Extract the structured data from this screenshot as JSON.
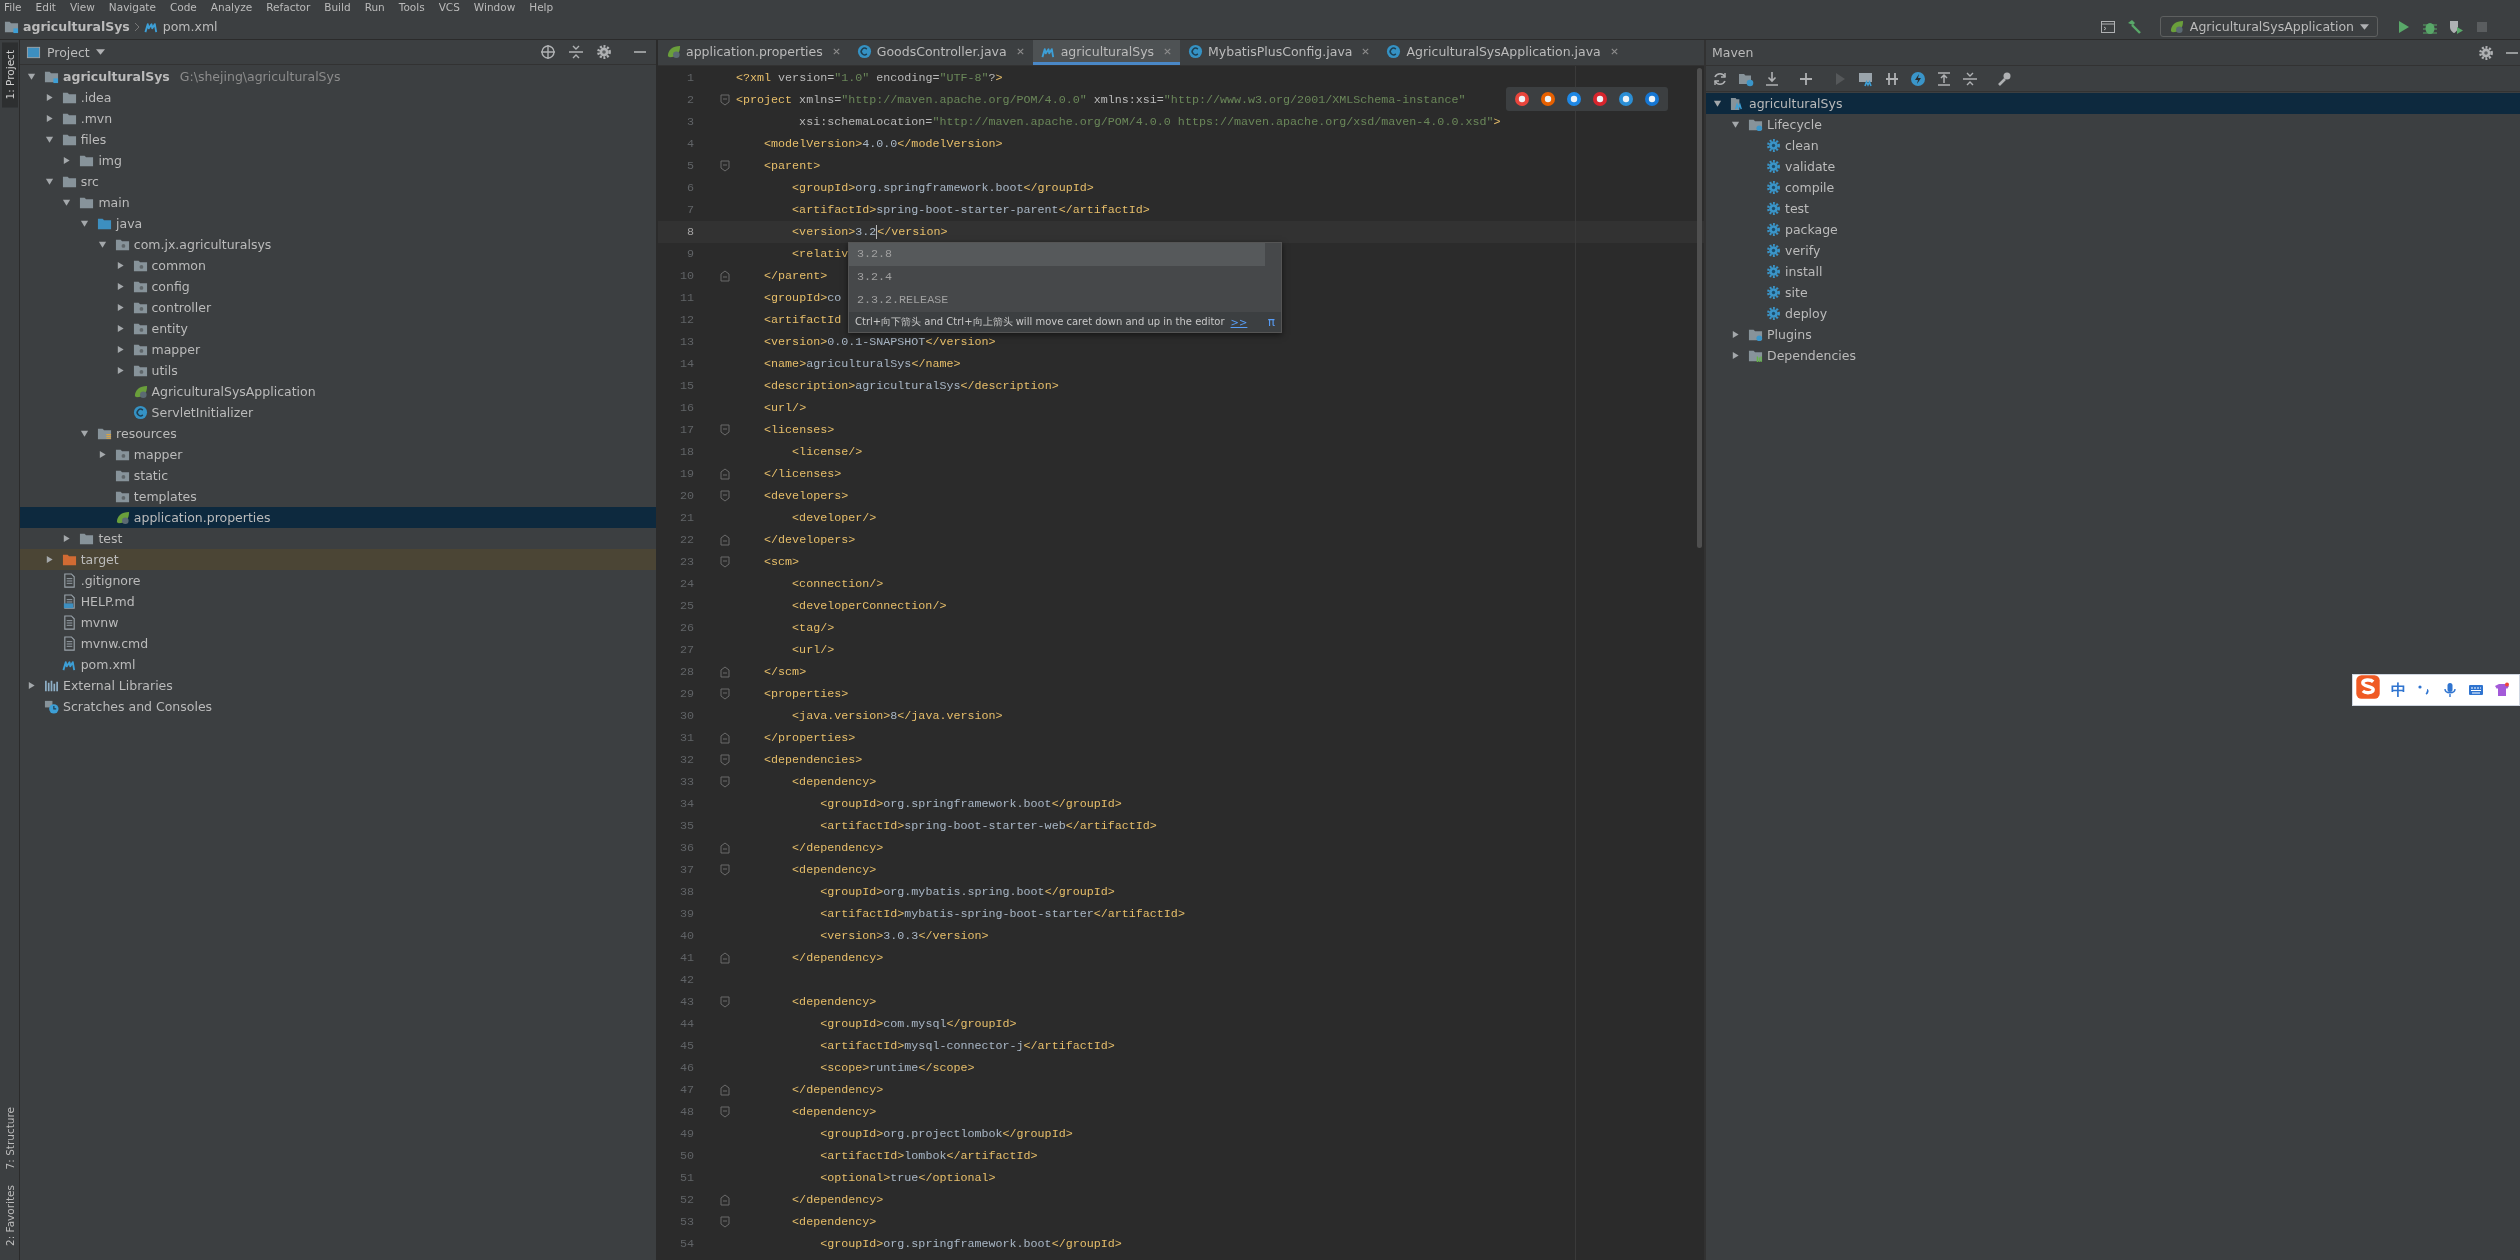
{
  "menu": [
    "File",
    "Edit",
    "View",
    "Navigate",
    "Code",
    "Analyze",
    "Refactor",
    "Build",
    "Run",
    "Tools",
    "VCS",
    "Window",
    "Help"
  ],
  "breadcrumb": [
    {
      "label": "agriculturalSys",
      "kind": "module"
    },
    {
      "label": "pom.xml",
      "kind": "maven"
    }
  ],
  "run_config": {
    "label": "AgriculturalSysApplication"
  },
  "side_tabs_top": [
    {
      "label": "1: Project",
      "selected": true
    }
  ],
  "side_tabs_bottom": [
    {
      "label": "7: Structure",
      "selected": false
    },
    {
      "label": "2: Favorites",
      "selected": false
    }
  ],
  "project_panel": {
    "title": "Project",
    "tree": [
      {
        "label": "agriculturalSys",
        "path": "G:\\shejing\\agriculturalSys",
        "kind": "module",
        "expanded": true,
        "selected": false,
        "children": [
          {
            "label": ".idea",
            "kind": "folder",
            "expanded": false,
            "selected": false
          },
          {
            "label": ".mvn",
            "kind": "folder",
            "expanded": false,
            "selected": false
          },
          {
            "label": "files",
            "kind": "folder",
            "expanded": true,
            "selected": false,
            "children": [
              {
                "label": "img",
                "kind": "folder",
                "expanded": false,
                "selected": false
              }
            ]
          },
          {
            "label": "src",
            "kind": "folder",
            "expanded": true,
            "selected": false,
            "children": [
              {
                "label": "main",
                "kind": "folder",
                "expanded": true,
                "selected": false,
                "children": [
                  {
                    "label": "java",
                    "kind": "source",
                    "expanded": true,
                    "selected": false,
                    "children": [
                      {
                        "label": "com.jx.agriculturalsys",
                        "kind": "package",
                        "expanded": true,
                        "selected": false,
                        "children": [
                          {
                            "label": "common",
                            "kind": "package",
                            "expanded": false,
                            "selected": false
                          },
                          {
                            "label": "config",
                            "kind": "package",
                            "expanded": false,
                            "selected": false
                          },
                          {
                            "label": "controller",
                            "kind": "package",
                            "expanded": false,
                            "selected": false
                          },
                          {
                            "label": "entity",
                            "kind": "package",
                            "expanded": false,
                            "selected": false
                          },
                          {
                            "label": "mapper",
                            "kind": "package",
                            "expanded": false,
                            "selected": false
                          },
                          {
                            "label": "utils",
                            "kind": "package",
                            "expanded": false,
                            "selected": false
                          },
                          {
                            "label": "AgriculturalSysApplication",
                            "kind": "spring",
                            "selected": false
                          },
                          {
                            "label": "ServletInitializer",
                            "kind": "class",
                            "selected": false
                          }
                        ]
                      }
                    ]
                  },
                  {
                    "label": "resources",
                    "kind": "resources",
                    "expanded": true,
                    "selected": false,
                    "children": [
                      {
                        "label": "mapper",
                        "kind": "package",
                        "expanded": false,
                        "selected": false
                      },
                      {
                        "label": "static",
                        "kind": "package",
                        "selected": false
                      },
                      {
                        "label": "templates",
                        "kind": "package",
                        "selected": false
                      },
                      {
                        "label": "application.properties",
                        "kind": "properties",
                        "selected": true
                      }
                    ]
                  }
                ]
              },
              {
                "label": "test",
                "kind": "folder",
                "expanded": false,
                "selected": false
              }
            ]
          },
          {
            "label": "target",
            "kind": "excluded",
            "expanded": false,
            "selected": false
          },
          {
            "label": ".gitignore",
            "kind": "file",
            "selected": false
          },
          {
            "label": "HELP.md",
            "kind": "markdown",
            "selected": false
          },
          {
            "label": "mvnw",
            "kind": "file",
            "selected": false
          },
          {
            "label": "mvnw.cmd",
            "kind": "file",
            "selected": false
          },
          {
            "label": "pom.xml",
            "kind": "maven",
            "selected": false
          }
        ]
      },
      {
        "label": "External Libraries",
        "kind": "libraries",
        "expanded": false,
        "selected": false
      },
      {
        "label": "Scratches and Consoles",
        "kind": "scratches",
        "selected": false
      }
    ]
  },
  "editor": {
    "tabs": [
      {
        "label": "application.properties",
        "kind": "properties",
        "selected": false
      },
      {
        "label": "GoodsController.java",
        "kind": "class",
        "selected": false
      },
      {
        "label": "agriculturalSys",
        "kind": "maven",
        "selected": true
      },
      {
        "label": "MybatisPlusConfig.java",
        "kind": "class",
        "selected": false
      },
      {
        "label": "AgriculturalSysApplication.java",
        "kind": "class",
        "selected": false
      }
    ],
    "lines": [
      {
        "n": "1",
        "text": "<?xml version=\"1.0\" encoding=\"UTF-8\"?>",
        "current": false
      },
      {
        "n": "2",
        "text": "<project xmlns=\"http://maven.apache.org/POM/4.0.0\" xmlns:xsi=\"http://www.w3.org/2001/XMLSchema-instance\"",
        "fold_start": true,
        "current": false
      },
      {
        "n": "3",
        "text": "         xsi:schemaLocation=\"http://maven.apache.org/POM/4.0.0 https://maven.apache.org/xsd/maven-4.0.0.xsd\">",
        "current": false
      },
      {
        "n": "4",
        "text": "    <modelVersion>4.0.0</modelVersion>",
        "current": false
      },
      {
        "n": "5",
        "text": "    <parent>",
        "fold_start": true,
        "current": false
      },
      {
        "n": "6",
        "text": "        <groupId>org.springframework.boot</groupId>",
        "current": false
      },
      {
        "n": "7",
        "text": "        <artifactId>spring-boot-starter-parent</artifactId>",
        "current": false
      },
      {
        "n": "8",
        "text": "        <version>3.2",
        "after_caret": "</version>",
        "current": true
      },
      {
        "n": "9",
        "text": "        <relativ",
        "current": false
      },
      {
        "n": "10",
        "text": "    </parent>",
        "fold_end": true,
        "current": false
      },
      {
        "n": "11",
        "text": "    <groupId>co",
        "current": false
      },
      {
        "n": "12",
        "text": "    <artifactId",
        "current": false
      },
      {
        "n": "13",
        "text": "    <version>0.0.1-SNAPSHOT</version>",
        "current": false
      },
      {
        "n": "14",
        "text": "    <name>agriculturalSys</name>",
        "current": false
      },
      {
        "n": "15",
        "text": "    <description>agriculturalSys</description>",
        "current": false
      },
      {
        "n": "16",
        "text": "    <url/>",
        "current": false
      },
      {
        "n": "17",
        "text": "    <licenses>",
        "fold_start": true,
        "current": false
      },
      {
        "n": "18",
        "text": "        <license/>",
        "current": false
      },
      {
        "n": "19",
        "text": "    </licenses>",
        "fold_end": true,
        "current": false
      },
      {
        "n": "20",
        "text": "    <developers>",
        "fold_start": true,
        "current": false
      },
      {
        "n": "21",
        "text": "        <developer/>",
        "current": false
      },
      {
        "n": "22",
        "text": "    </developers>",
        "fold_end": true,
        "current": false
      },
      {
        "n": "23",
        "text": "    <scm>",
        "fold_start": true,
        "current": false
      },
      {
        "n": "24",
        "text": "        <connection/>",
        "current": false
      },
      {
        "n": "25",
        "text": "        <developerConnection/>",
        "current": false
      },
      {
        "n": "26",
        "text": "        <tag/>",
        "current": false
      },
      {
        "n": "27",
        "text": "        <url/>",
        "current": false
      },
      {
        "n": "28",
        "text": "    </scm>",
        "fold_end": true,
        "current": false
      },
      {
        "n": "29",
        "text": "    <properties>",
        "fold_start": true,
        "current": false
      },
      {
        "n": "30",
        "text": "        <java.version>8</java.version>",
        "current": false
      },
      {
        "n": "31",
        "text": "    </properties>",
        "fold_end": true,
        "current": false
      },
      {
        "n": "32",
        "text": "    <dependencies>",
        "fold_start": true,
        "current": false
      },
      {
        "n": "33",
        "text": "        <dependency>",
        "fold_start": true,
        "current": false
      },
      {
        "n": "34",
        "text": "            <groupId>org.springframework.boot</groupId>",
        "current": false
      },
      {
        "n": "35",
        "text": "            <artifactId>spring-boot-starter-web</artifactId>",
        "current": false
      },
      {
        "n": "36",
        "text": "        </dependency>",
        "fold_end": true,
        "current": false
      },
      {
        "n": "37",
        "text": "        <dependency>",
        "fold_start": true,
        "current": false
      },
      {
        "n": "38",
        "text": "            <groupId>org.mybatis.spring.boot</groupId>",
        "current": false
      },
      {
        "n": "39",
        "text": "            <artifactId>mybatis-spring-boot-starter</artifactId>",
        "current": false
      },
      {
        "n": "40",
        "text": "            <version>3.0.3</version>",
        "current": false
      },
      {
        "n": "41",
        "text": "        </dependency>",
        "fold_end": true,
        "current": false
      },
      {
        "n": "42",
        "current": false
      },
      {
        "n": "43",
        "text": "        <dependency>",
        "fold_start": true,
        "current": false
      },
      {
        "n": "44",
        "text": "            <groupId>com.mysql</groupId>",
        "current": false
      },
      {
        "n": "45",
        "text": "            <artifactId>mysql-connector-j</artifactId>",
        "current": false
      },
      {
        "n": "46",
        "text": "            <scope>runtime</scope>",
        "current": false
      },
      {
        "n": "47",
        "text": "        </dependency>",
        "fold_end": true,
        "current": false
      },
      {
        "n": "48",
        "text": "        <dependency>",
        "fold_start": true,
        "current": false
      },
      {
        "n": "49",
        "text": "            <groupId>org.projectlombok</groupId>",
        "current": false
      },
      {
        "n": "50",
        "text": "            <artifactId>lombok</artifactId>",
        "current": false
      },
      {
        "n": "51",
        "text": "            <optional>true</optional>",
        "current": false
      },
      {
        "n": "52",
        "text": "        </dependency>",
        "fold_end": true,
        "current": false
      },
      {
        "n": "53",
        "text": "        <dependency>",
        "fold_start": true,
        "current": false
      },
      {
        "n": "54",
        "text": "            <groupId>org.springframework.boot</groupId>",
        "current": false
      }
    ],
    "completion": {
      "items": [
        {
          "label": "3.2.8",
          "selected": true
        },
        {
          "label": "3.2.4",
          "selected": false
        },
        {
          "label": "2.3.2.RELEASE",
          "selected": false
        }
      ],
      "hint": "Ctrl+向下箭头 and Ctrl+向上箭头 will move caret down and up in the editor",
      "link": ">>",
      "mark": "π"
    }
  },
  "maven": {
    "title": "Maven",
    "tree": [
      {
        "label": "agriculturalSys",
        "kind": "project",
        "expanded": true,
        "selected": true,
        "children": [
          {
            "label": "Lifecycle",
            "kind": "lifecycle",
            "expanded": true,
            "selected": false,
            "children": [
              {
                "label": "clean",
                "kind": "goal",
                "selected": false
              },
              {
                "label": "validate",
                "kind": "goal",
                "selected": false
              },
              {
                "label": "compile",
                "kind": "goal",
                "selected": false
              },
              {
                "label": "test",
                "kind": "goal",
                "selected": false
              },
              {
                "label": "package",
                "kind": "goal",
                "selected": false
              },
              {
                "label": "verify",
                "kind": "goal",
                "selected": false
              },
              {
                "label": "install",
                "kind": "goal",
                "selected": false
              },
              {
                "label": "site",
                "kind": "goal",
                "selected": false
              },
              {
                "label": "deploy",
                "kind": "goal",
                "selected": false
              }
            ]
          },
          {
            "label": "Plugins",
            "kind": "plugins",
            "expanded": false,
            "selected": false
          },
          {
            "label": "Dependencies",
            "kind": "dependencies",
            "expanded": false,
            "selected": false
          }
        ]
      }
    ]
  },
  "ime_bar": {
    "mode": "中"
  }
}
